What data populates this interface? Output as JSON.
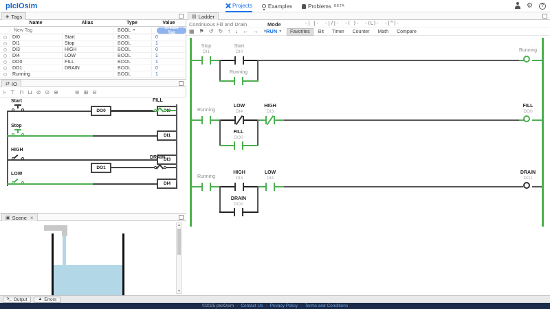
{
  "topbar": {
    "logo": "plcIOsim",
    "nav_projects": "Projects",
    "nav_examples": "Examples",
    "nav_problems": "Problems",
    "beta": "BETA"
  },
  "tags": {
    "title": "Tags",
    "headers": {
      "name": "Name",
      "alias": "Alias",
      "type": "Type",
      "value": "Value"
    },
    "new_tag": {
      "placeholder": "New Tag",
      "type": "BOOL",
      "create": "Create Tag"
    },
    "rows": [
      {
        "name": "DI0",
        "alias": "Start",
        "type": "BOOL",
        "value": "0"
      },
      {
        "name": "DI1",
        "alias": "Stop",
        "type": "BOOL",
        "value": "1"
      },
      {
        "name": "DI3",
        "alias": "HIGH",
        "type": "BOOL",
        "value": "0"
      },
      {
        "name": "DI4",
        "alias": "LOW",
        "type": "BOOL",
        "value": "1"
      },
      {
        "name": "DO0",
        "alias": "FILL",
        "type": "BOOL",
        "value": "1"
      },
      {
        "name": "DO1",
        "alias": "DRAIN",
        "type": "BOOL",
        "value": "0"
      },
      {
        "name": "Running",
        "alias": "",
        "type": "BOOL",
        "value": "1"
      }
    ]
  },
  "io": {
    "title": "IO",
    "inputs": [
      {
        "label": "Start",
        "address": "DI0"
      },
      {
        "label": "Stop",
        "address": "DI1"
      },
      {
        "label": "HIGH",
        "address": "DI3"
      },
      {
        "label": "LOW",
        "address": "DI4"
      }
    ],
    "outputs": [
      {
        "label": "FILL",
        "address": "DO0"
      },
      {
        "label": "DRAIN",
        "address": "DO1"
      }
    ]
  },
  "scene": {
    "title": "Scene"
  },
  "ladder": {
    "title": "Ladder",
    "project_title": "Continuous Fill and Drain",
    "mode_label": "Mode",
    "mode_value": "RUN",
    "tabs": [
      "Favorites",
      "Bit",
      "Timer",
      "Counter",
      "Math",
      "Compare"
    ],
    "rungs": [
      {
        "contacts": [
          {
            "alias": "Stop",
            "addr": "DI1"
          },
          {
            "alias": "Start",
            "addr": "DI0"
          }
        ],
        "branch": {
          "alias": "Running",
          "addr": ""
        },
        "coil": {
          "alias": "Running",
          "addr": ""
        }
      },
      {
        "contacts": [
          {
            "alias": "Running",
            "addr": ""
          },
          {
            "alias": "LOW",
            "addr": "DI4"
          },
          {
            "alias": "HIGH",
            "addr": "DI3"
          }
        ],
        "branch": {
          "alias": "FILL",
          "addr": "DO0"
        },
        "coil": {
          "alias": "FILL",
          "addr": "DO0"
        }
      },
      {
        "contacts": [
          {
            "alias": "Running",
            "addr": ""
          },
          {
            "alias": "HIGH",
            "addr": "DI3"
          },
          {
            "alias": "LOW",
            "addr": "DI4"
          }
        ],
        "branch": {
          "alias": "DRAIN",
          "addr": "DO1"
        },
        "coil": {
          "alias": "DRAIN",
          "addr": "DO1"
        }
      }
    ]
  },
  "bottom": {
    "output": "Output",
    "errors": "Errors"
  },
  "footer": {
    "copyright": "©2025 plcIOsim",
    "link1": "Contact Us",
    "link2": "Privacy Policy",
    "link3": "Terms and Conditions",
    "separator": "·"
  },
  "icons": {
    "tags": "◈",
    "io": "⇄",
    "scene": "▣",
    "ladder": "▤",
    "select": "▦",
    "flag": "⚑",
    "undo": "↺",
    "redo": "↻",
    "up": "↑",
    "down": "↓",
    "left": "←",
    "right": "→",
    "delete": "×",
    "no_contact": "-| |-",
    "nc_contact": "-|/|-",
    "coil": "-( )-",
    "latch_coil": "-(L)-",
    "oneshot": "-[^]-",
    "gear": "⚙",
    "help": "?",
    "dropdown": "▼",
    "close": "×",
    "output_prompt": ">_",
    "warning": "▲",
    "io_left_1": "⊦",
    "io_left_2": "⊤",
    "io_left_3": "⊓",
    "io_left_4": "⊔",
    "io_left_5": "⊘",
    "io_left_6": "⊙",
    "io_left_7": "⊕",
    "io_right_1": "⊛",
    "io_right_2": "⊞",
    "io_right_3": "⊝",
    "scroll_up": "▲",
    "scroll_down": "▼"
  },
  "colors": {
    "energized": "#4caf50",
    "accent": "#1a73e8",
    "brand": "#1666c5",
    "water": "#b2d8e8"
  }
}
